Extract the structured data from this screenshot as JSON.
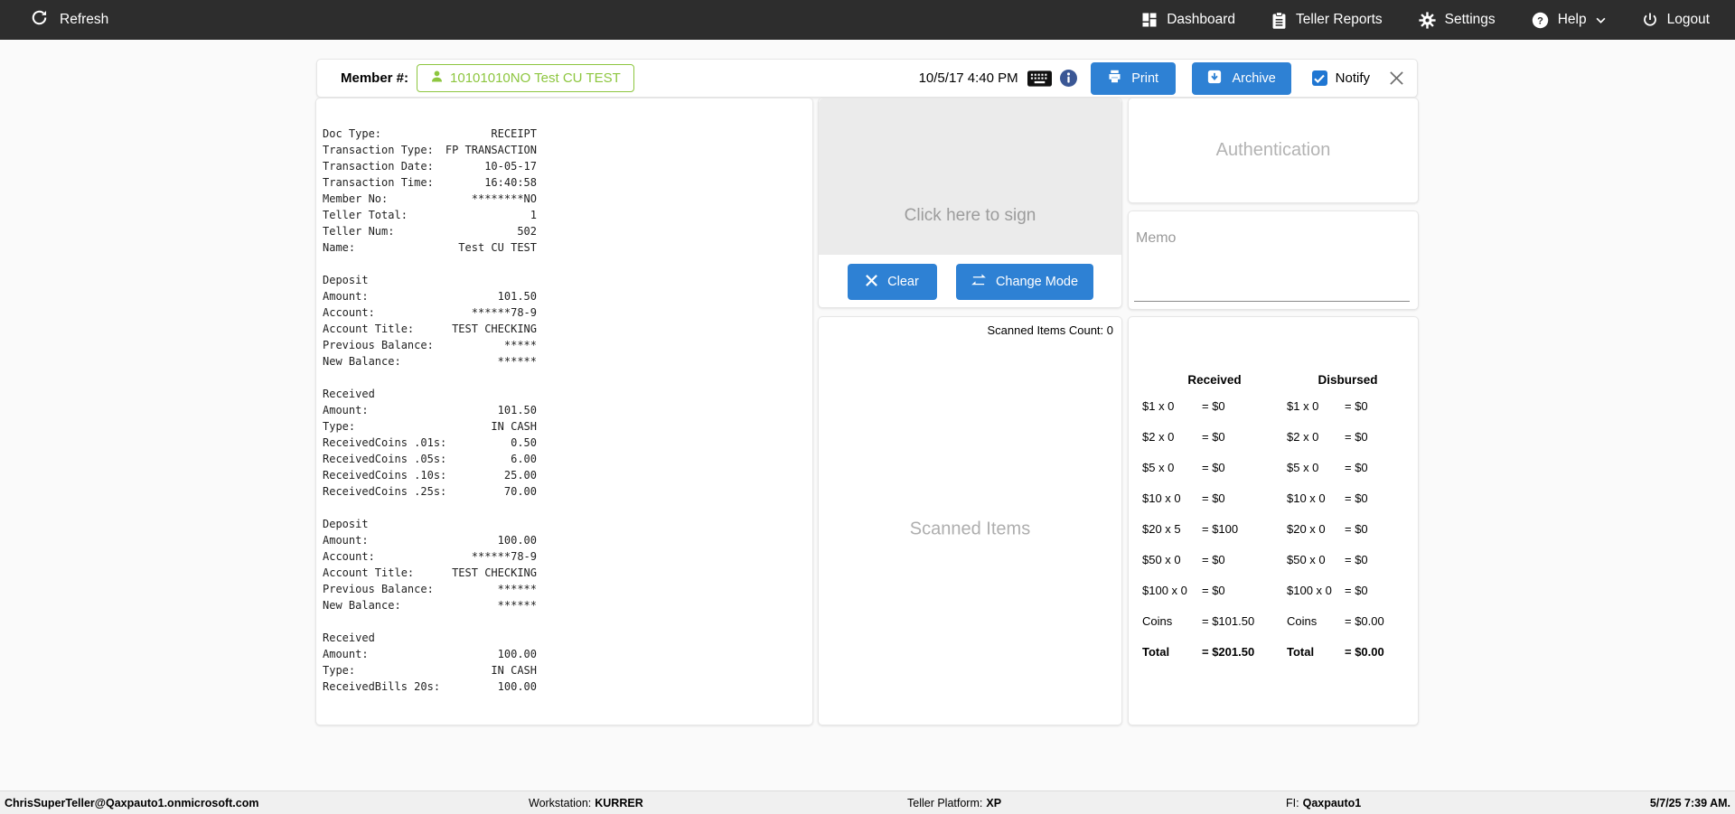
{
  "topnav": {
    "refresh_label": "Refresh",
    "items": [
      {
        "label": "Dashboard"
      },
      {
        "label": "Teller Reports"
      },
      {
        "label": "Settings"
      },
      {
        "label": "Help"
      },
      {
        "label": "Logout"
      }
    ]
  },
  "header": {
    "member_label": "Member #:",
    "member_value": "10101010NO Test CU TEST",
    "timestamp": "10/5/17 4:40 PM",
    "print_label": "Print",
    "archive_label": "Archive",
    "notify_label": "Notify",
    "notify_checked": true
  },
  "receipt": {
    "lines": [
      {
        "l": "Doc Type:",
        "v": "RECEIPT"
      },
      {
        "l": "Transaction Type:",
        "v": "FP TRANSACTION"
      },
      {
        "l": "Transaction Date:",
        "v": "10-05-17"
      },
      {
        "l": "Transaction Time:",
        "v": "16:40:58"
      },
      {
        "l": "Member No:",
        "v": "********NO"
      },
      {
        "l": "Teller Total:",
        "v": "1"
      },
      {
        "l": "Teller Num:",
        "v": "502"
      },
      {
        "l": "Name:",
        "v": "Test CU TEST"
      },
      {
        "l": "",
        "v": ""
      },
      {
        "l": "Deposit",
        "v": ""
      },
      {
        "l": "Amount:",
        "v": "101.50"
      },
      {
        "l": "Account:",
        "v": "******78-9"
      },
      {
        "l": "Account Title:",
        "v": "TEST CHECKING"
      },
      {
        "l": "Previous Balance:",
        "v": "*****"
      },
      {
        "l": "New Balance:",
        "v": "******"
      },
      {
        "l": "",
        "v": ""
      },
      {
        "l": "Received",
        "v": ""
      },
      {
        "l": "Amount:",
        "v": "101.50"
      },
      {
        "l": "Type:",
        "v": "IN CASH"
      },
      {
        "l": "ReceivedCoins .01s:",
        "v": "0.50"
      },
      {
        "l": "ReceivedCoins .05s:",
        "v": "6.00"
      },
      {
        "l": "ReceivedCoins .10s:",
        "v": "25.00"
      },
      {
        "l": "ReceivedCoins .25s:",
        "v": "70.00"
      },
      {
        "l": "",
        "v": ""
      },
      {
        "l": "Deposit",
        "v": ""
      },
      {
        "l": "Amount:",
        "v": "100.00"
      },
      {
        "l": "Account:",
        "v": "******78-9"
      },
      {
        "l": "Account Title:",
        "v": "TEST CHECKING"
      },
      {
        "l": "Previous Balance:",
        "v": "******"
      },
      {
        "l": "New Balance:",
        "v": "******"
      },
      {
        "l": "",
        "v": ""
      },
      {
        "l": "Received",
        "v": ""
      },
      {
        "l": "Amount:",
        "v": "100.00"
      },
      {
        "l": "Type:",
        "v": "IN CASH"
      },
      {
        "l": "ReceivedBills 20s:",
        "v": "100.00"
      }
    ]
  },
  "signature": {
    "placeholder": "Click here to sign",
    "clear_label": "Clear",
    "change_mode_label": "Change Mode"
  },
  "scanned": {
    "count_text": "Scanned Items Count: 0",
    "placeholder": "Scanned Items"
  },
  "authentication": {
    "placeholder": "Authentication"
  },
  "memo": {
    "placeholder": "Memo"
  },
  "cash": {
    "received_header": "Received",
    "disbursed_header": "Disbursed",
    "rows": [
      {
        "rl": "$1 x 0",
        "rv": "= $0",
        "dl": "$1 x 0",
        "dv": "= $0",
        "bold": false
      },
      {
        "rl": "$2 x 0",
        "rv": "= $0",
        "dl": "$2 x 0",
        "dv": "= $0",
        "bold": false
      },
      {
        "rl": "$5 x 0",
        "rv": "= $0",
        "dl": "$5 x 0",
        "dv": "= $0",
        "bold": false
      },
      {
        "rl": "$10 x 0",
        "rv": "= $0",
        "dl": "$10 x 0",
        "dv": "= $0",
        "bold": false
      },
      {
        "rl": "$20 x 5",
        "rv": "= $100",
        "dl": "$20 x 0",
        "dv": "= $0",
        "bold": false
      },
      {
        "rl": "$50 x 0",
        "rv": "= $0",
        "dl": "$50 x 0",
        "dv": "= $0",
        "bold": false
      },
      {
        "rl": "$100 x 0",
        "rv": "= $0",
        "dl": "$100 x 0",
        "dv": "= $0",
        "bold": false
      },
      {
        "rl": "Coins",
        "rv": "= $101.50",
        "dl": "Coins",
        "dv": "= $0.00",
        "bold": false
      },
      {
        "rl": "Total",
        "rv": "= $201.50",
        "dl": "Total",
        "dv": "= $0.00",
        "bold": true
      }
    ]
  },
  "statusbar": {
    "user": "ChrisSuperTeller@Qaxpauto1.onmicrosoft.com",
    "workstation_label": "Workstation:",
    "workstation_value": "KURRER",
    "platform_label": "Teller Platform:",
    "platform_value": "XP",
    "fi_label": "FI:",
    "fi_value": "Qaxpauto1",
    "datetime": "5/7/25 7:39 AM."
  },
  "colors": {
    "topnav_bg": "#2d2d2d",
    "accent_blue": "#2e81d4",
    "checkbox_blue": "#1f76d2",
    "member_green": "#8dc63f",
    "info_navy": "#3a5795",
    "placeholder_gray": "#aeaeae"
  }
}
